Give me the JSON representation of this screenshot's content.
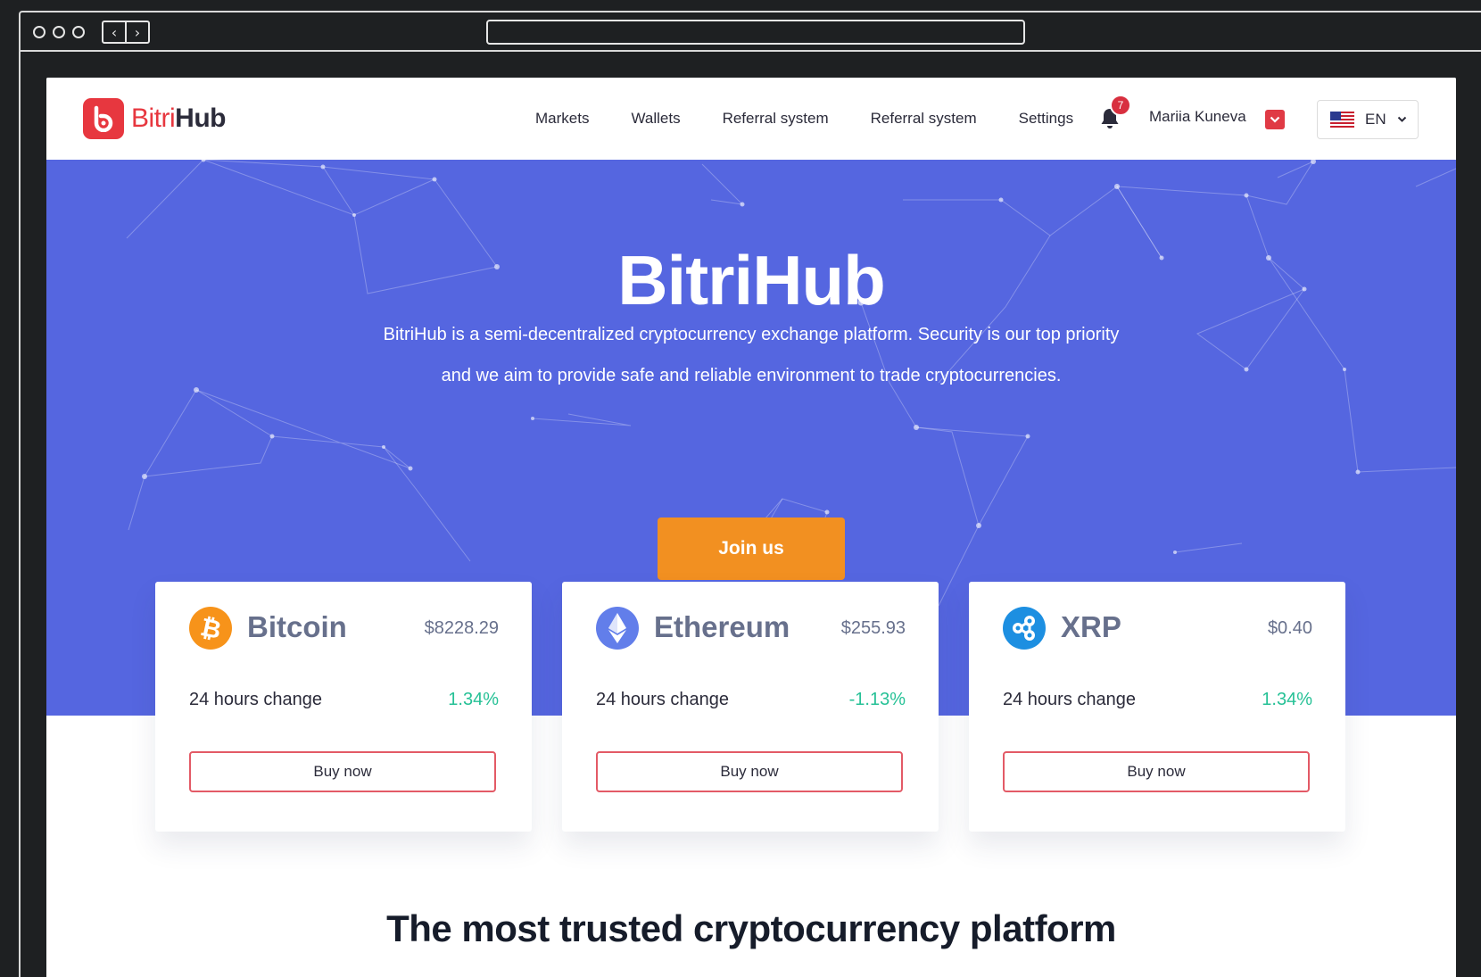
{
  "site": {
    "logo_prefix": "Bitri",
    "logo_suffix": "Hub"
  },
  "nav": {
    "items": [
      "Markets",
      "Wallets",
      "Referral system",
      "Referral system",
      "Settings"
    ],
    "notifications_count": "7",
    "user_name": "Mariia Kuneva",
    "language": "EN"
  },
  "hero": {
    "title": "BitriHub",
    "description_line1": "BitriHub is a semi-decentralized cryptocurrency exchange platform. Security is our top priority",
    "description_line2": "and we aim to provide safe and reliable environment to trade cryptocurrencies.",
    "cta_label": "Join us"
  },
  "coins": [
    {
      "name": "Bitcoin",
      "price": "$8228.29",
      "change_label": "24 hours change",
      "change": "1.34%",
      "buy_label": "Buy now",
      "icon": "bitcoin-icon",
      "color": "#f7931a"
    },
    {
      "name": "Ethereum",
      "price": "$255.93",
      "change_label": "24 hours change",
      "change": "-1.13%",
      "buy_label": "Buy now",
      "icon": "ethereum-icon",
      "color": "#627eea"
    },
    {
      "name": "XRP",
      "price": "$0.40",
      "change_label": "24 hours change",
      "change": "1.34%",
      "buy_label": "Buy now",
      "icon": "xrp-icon",
      "color": "#1d8fe1"
    }
  ],
  "section": {
    "title": "The most trusted cryptocurrency platform"
  },
  "colors": {
    "brand": "#e7373f",
    "hero": "#5566e0",
    "cta": "#f29021",
    "positive": "#26c196"
  }
}
